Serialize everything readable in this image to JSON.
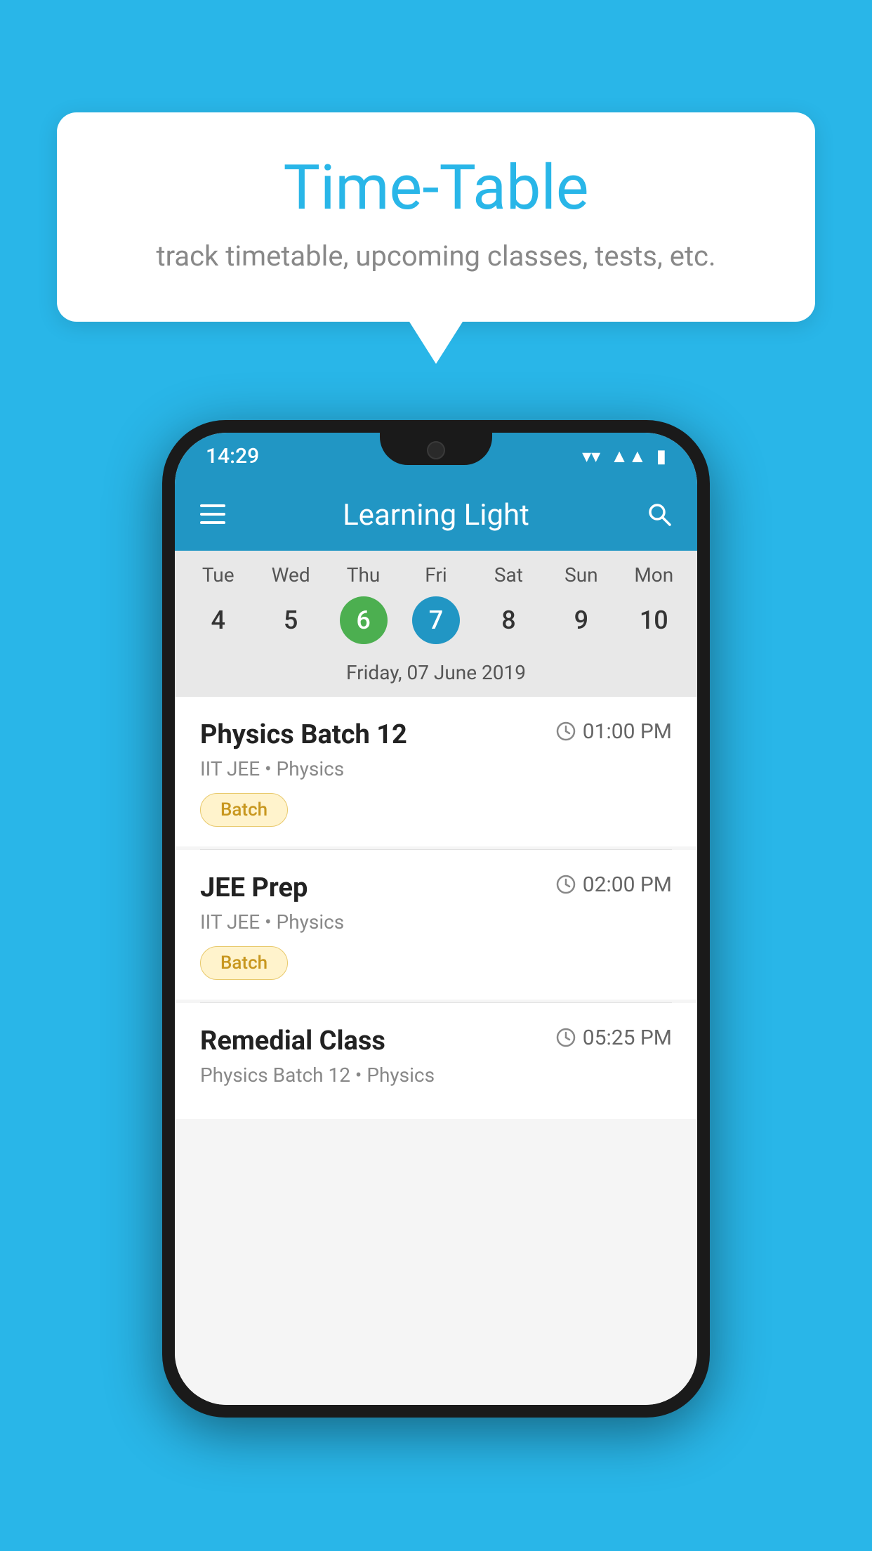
{
  "background_color": "#29B6E8",
  "bubble": {
    "title": "Time-Table",
    "subtitle": "track timetable, upcoming classes, tests, etc."
  },
  "phone": {
    "status_bar": {
      "time": "14:29"
    },
    "app_bar": {
      "title": "Learning Light"
    },
    "calendar": {
      "days": [
        "Tue",
        "Wed",
        "Thu",
        "Fri",
        "Sat",
        "Sun",
        "Mon"
      ],
      "numbers": [
        "4",
        "5",
        "6",
        "7",
        "8",
        "9",
        "10"
      ],
      "today_index": 2,
      "selected_index": 3,
      "selected_date_label": "Friday, 07 June 2019"
    },
    "schedule": [
      {
        "name": "Physics Batch 12",
        "time": "01:00 PM",
        "sub": "IIT JEE • Physics",
        "badge": "Batch"
      },
      {
        "name": "JEE Prep",
        "time": "02:00 PM",
        "sub": "IIT JEE • Physics",
        "badge": "Batch"
      },
      {
        "name": "Remedial Class",
        "time": "05:25 PM",
        "sub": "Physics Batch 12 • Physics",
        "badge": null
      }
    ]
  }
}
